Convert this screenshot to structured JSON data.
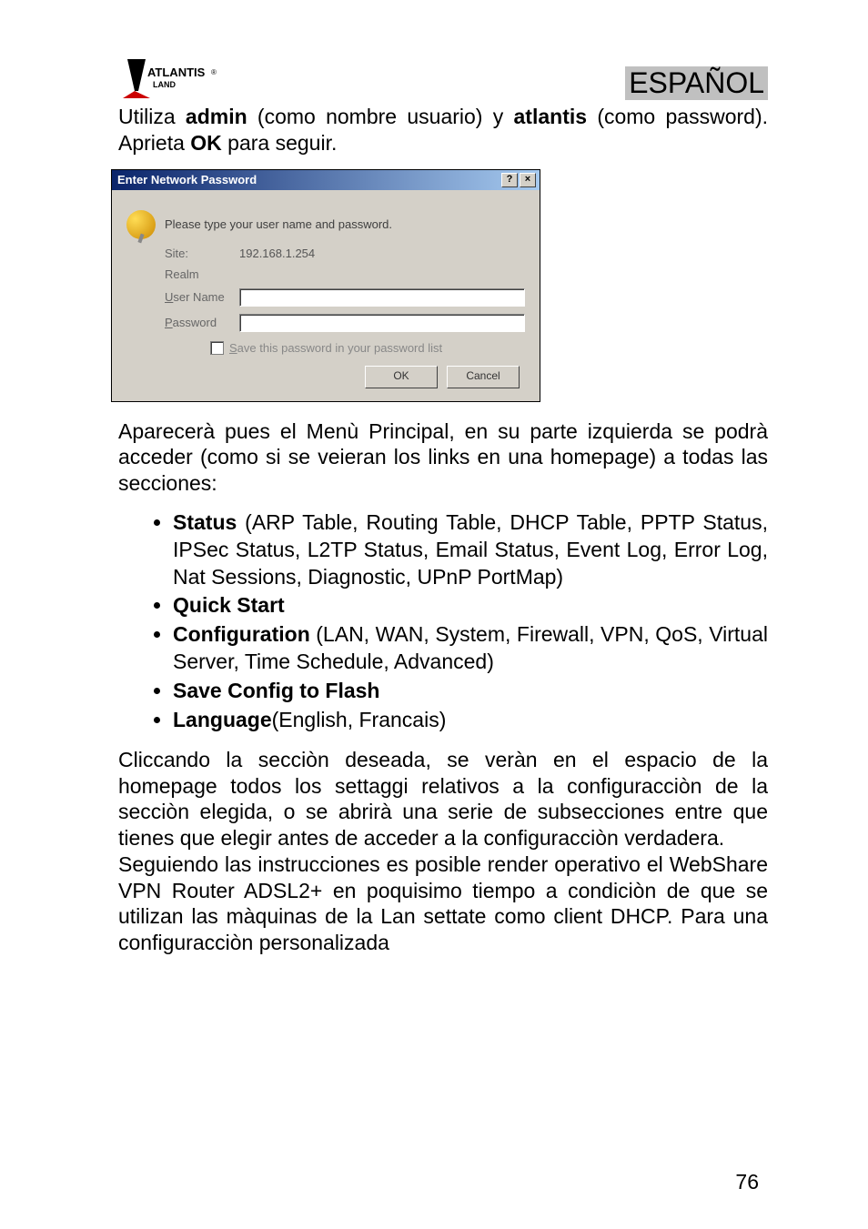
{
  "header": {
    "logo_text_top": "ATLANTIS",
    "logo_text_bottom": "LAND",
    "language_tag": "ESPAÑOL"
  },
  "intro": {
    "prefix": "Utiliza ",
    "user_bold": "admin",
    "middle": " (como nombre usuario) y ",
    "pass_bold": "atlantis",
    "middle2": " (como password). Aprieta ",
    "ok_bold": "OK",
    "suffix": " para seguir."
  },
  "dialog": {
    "title": "Enter Network Password",
    "help_btn": "?",
    "close_btn": "×",
    "prompt": "Please type your user name and password.",
    "site_label": "Site:",
    "site_value": "192.168.1.254",
    "realm_label": "Realm",
    "user_label": "User Name",
    "user_value": "",
    "pass_label": "Password",
    "pass_value": "",
    "save_label": "Save this password in your password list",
    "ok": "OK",
    "cancel": "Cancel"
  },
  "after_dialog": "Aparecerà pues el Menù Principal, en su parte izquierda se podrà acceder (como si se veieran los links en una homepage) a todas las secciones:",
  "menu": {
    "items": [
      {
        "bold": "Status",
        "rest": " (ARP Table, Routing Table, DHCP Table, PPTP Status, IPSec Status, L2TP Status, Email Status, Event Log, Error Log,  Nat Sessions, Diagnostic, UPnP PortMap)"
      },
      {
        "bold": "Quick Start",
        "rest": ""
      },
      {
        "bold": "Configuration",
        "rest": " (LAN, WAN, System, Firewall, VPN, QoS,  Virtual Server, Time Schedule, Advanced)"
      },
      {
        "bold": "Save Config to Flash",
        "rest": ""
      },
      {
        "bold": "Language",
        "rest": "(English, Francais)"
      }
    ]
  },
  "closing": "Cliccando la secciòn deseada, se veràn en el espacio de la homepage todos los settaggi relativos a la configuracciòn de la secciòn elegida, o se abrirà una serie de subsecciones entre que tienes que elegir antes de acceder a la configuracciòn verdadera.\nSeguiendo las instrucciones es posible render operativo el WebShare  VPN Router ADSL2+ en poquisimo tiempo a condiciòn de que se utilizan las màquinas de la Lan settate como client DHCP. Para una configuracciòn personalizada",
  "page_number": "76"
}
